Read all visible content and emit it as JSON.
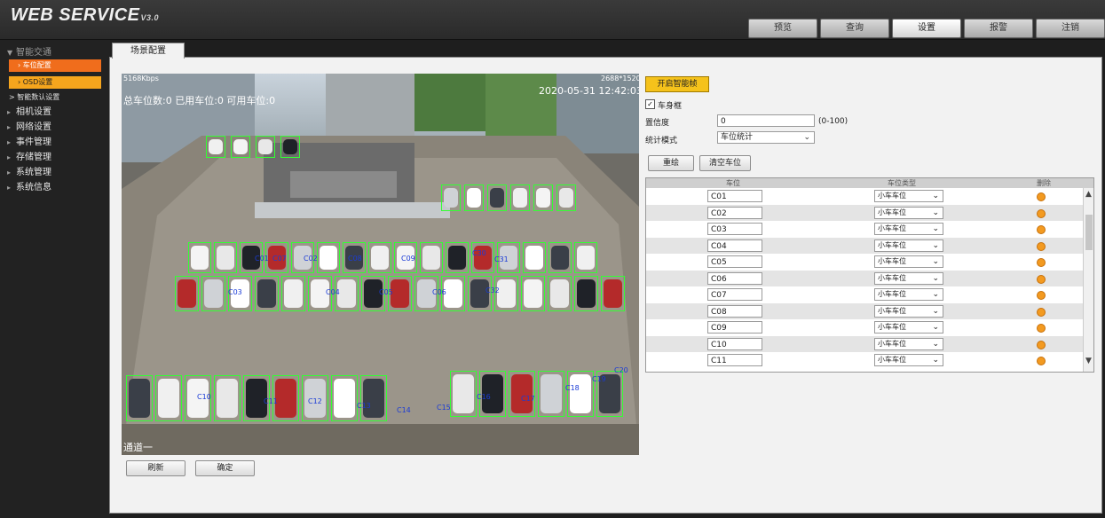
{
  "header": {
    "logo": "WEB SERVICE",
    "version": "V3.0",
    "nav": [
      "预览",
      "查询",
      "设置",
      "报警",
      "注销"
    ],
    "active_nav": "设置"
  },
  "sidebar": {
    "group": "智能交通",
    "subitems": [
      "车位配置",
      "OSD设置",
      "智能数认设置"
    ],
    "items": [
      "相机设置",
      "网络设置",
      "事件管理",
      "存储管理",
      "系统管理",
      "系统信息"
    ]
  },
  "page_tab": "场景配置",
  "video": {
    "bitrate": "5168Kbps",
    "resolution": "2688*1520",
    "timestamp": "2020-05-31 12:42:03",
    "osd_text": "总车位数:0 已用车位:0 可用车位:0",
    "channel": "通道一",
    "spot_labels": [
      "C01",
      "C02",
      "C03",
      "C04",
      "C05",
      "C06",
      "C07",
      "C08",
      "C09",
      "C10",
      "C11",
      "C12",
      "C13",
      "C14",
      "C15",
      "C16",
      "C17",
      "C18",
      "C19",
      "C20",
      "C30",
      "C31",
      "C32"
    ]
  },
  "buttons": {
    "refresh": "刷新",
    "confirm": "确定",
    "smart_frame": "开启智能帧",
    "redraw": "重绘",
    "clear": "清空车位"
  },
  "settings": {
    "body_frame_label": "车身框",
    "body_frame_checked": true,
    "confidence_label": "置信度",
    "confidence_value": "0",
    "confidence_range": "(0-100)",
    "stat_mode_label": "统计模式",
    "stat_mode_value": "车位统计"
  },
  "table": {
    "headers": [
      "车位",
      "车位类型",
      "删除"
    ],
    "rows": [
      {
        "id": "C01",
        "type": "小车车位"
      },
      {
        "id": "C02",
        "type": "小车车位"
      },
      {
        "id": "C03",
        "type": "小车车位"
      },
      {
        "id": "C04",
        "type": "小车车位"
      },
      {
        "id": "C05",
        "type": "小车车位"
      },
      {
        "id": "C06",
        "type": "小车车位"
      },
      {
        "id": "C07",
        "type": "小车车位"
      },
      {
        "id": "C08",
        "type": "小车车位"
      },
      {
        "id": "C09",
        "type": "小车车位"
      },
      {
        "id": "C10",
        "type": "小车车位"
      },
      {
        "id": "C11",
        "type": "小车车位"
      }
    ]
  },
  "colors": {
    "accent_orange": "#f06d1c",
    "accent_yellow": "#f5a51d",
    "button_yellow": "#f5c21b",
    "detect_green": "#33ff33",
    "delete_dot": "#f39a20"
  }
}
